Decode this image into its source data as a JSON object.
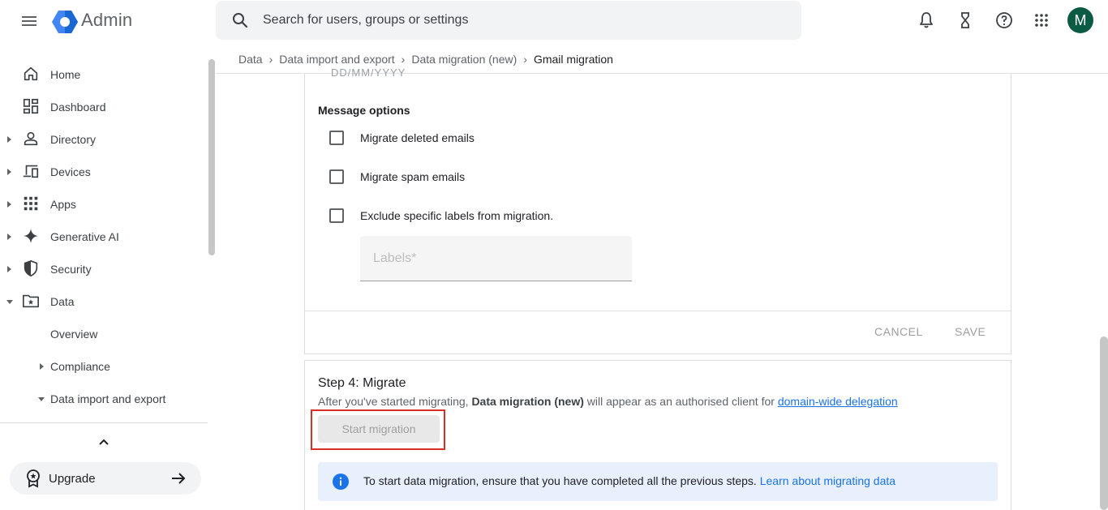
{
  "header": {
    "app_title": "Admin",
    "search_placeholder": "Search for users, groups or settings",
    "avatar_initial": "M"
  },
  "sidebar": {
    "items": [
      {
        "label": "Home"
      },
      {
        "label": "Dashboard"
      },
      {
        "label": "Directory"
      },
      {
        "label": "Devices"
      },
      {
        "label": "Apps"
      },
      {
        "label": "Generative AI"
      },
      {
        "label": "Security"
      },
      {
        "label": "Data"
      }
    ],
    "subitems": [
      {
        "label": "Overview"
      },
      {
        "label": "Compliance"
      },
      {
        "label": "Data import and export"
      }
    ],
    "upgrade_label": "Upgrade"
  },
  "breadcrumb": [
    "Data",
    "Data import and export",
    "Data migration (new)",
    "Gmail migration"
  ],
  "message_options": {
    "truncated_text": "DD/MM/YYYY",
    "title": "Message options",
    "checkboxes": [
      {
        "label": "Migrate deleted emails",
        "checked": false
      },
      {
        "label": "Migrate spam emails",
        "checked": false
      },
      {
        "label": "Exclude specific labels from migration.",
        "checked": false
      }
    ],
    "labels_placeholder": "Labels*",
    "cancel_label": "CANCEL",
    "save_label": "SAVE"
  },
  "step4": {
    "title": "Step 4: Migrate",
    "desc_prefix": "After you've started migrating,",
    "desc_bold": "Data migration (new)",
    "desc_middle": "will appear as an authorised client for",
    "desc_link": "domain-wide delegation",
    "start_button": "Start migration",
    "info_text": "To start data migration, ensure that you have completed all the previous steps.",
    "info_link": "Learn about migrating data"
  },
  "colors": {
    "accent": "#1a73e8",
    "avatar_bg": "#0b5b44",
    "highlight_border": "#d93025",
    "info_bg": "#e8f0fe"
  }
}
